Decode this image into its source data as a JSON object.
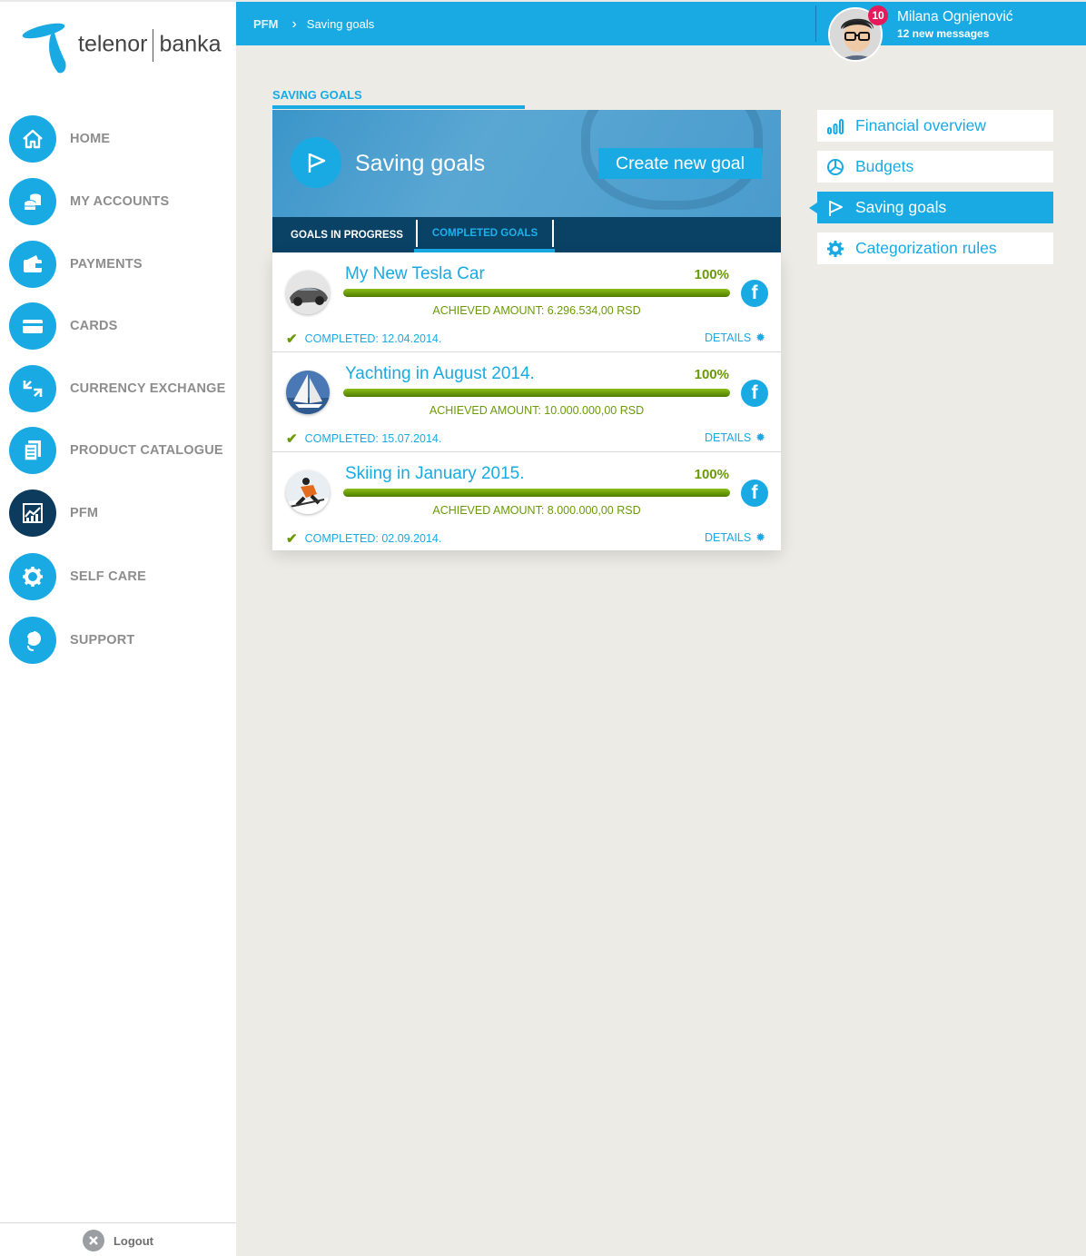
{
  "brand": {
    "name": "telenor",
    "product": "banka",
    "primary_color": "#19aae4",
    "dark_color": "#0a4266",
    "success_color": "#6a9a07"
  },
  "sidebar": {
    "items": [
      {
        "label": "HOME",
        "icon": "home-icon"
      },
      {
        "label": "MY ACCOUNTS",
        "icon": "coins-icon"
      },
      {
        "label": "PAYMENTS",
        "icon": "wallet-icon"
      },
      {
        "label": "CARDS",
        "icon": "card-icon"
      },
      {
        "label": "CURRENCY EXCHANGE",
        "icon": "exchange-icon"
      },
      {
        "label": "PRODUCT CATALOGUE",
        "icon": "catalogue-icon"
      },
      {
        "label": "PFM",
        "icon": "chart-icon",
        "active": true
      },
      {
        "label": "SELF CARE",
        "icon": "gear-icon"
      },
      {
        "label": "SUPPORT",
        "icon": "headset-icon"
      }
    ],
    "logout_label": "Logout"
  },
  "topbar": {
    "breadcrumb_root": "PFM",
    "breadcrumb_current": "Saving goals",
    "user_name": "Milana Ognjenović",
    "messages": "12 new messages",
    "badge_count": "10"
  },
  "main": {
    "section_title": "SAVING GOALS",
    "hero_title": "Saving goals",
    "create_button": "Create new goal",
    "tabs": [
      {
        "label": "GOALS IN PROGRESS",
        "active": false
      },
      {
        "label": "COMPLETED GOALS",
        "active": true
      }
    ],
    "goals": [
      {
        "name": "My New Tesla Car",
        "percent": "100%",
        "progress": 1.0,
        "achieved": "ACHIEVED AMOUNT: 6.296.534,00 RSD",
        "completed": "COMPLETED: 12.04.2014.",
        "details": "DETAILS",
        "image": "car"
      },
      {
        "name": "Yachting in August 2014.",
        "percent": "100%",
        "progress": 1.0,
        "achieved": "ACHIEVED AMOUNT: 10.000.000,00 RSD",
        "completed": "COMPLETED: 15.07.2014.",
        "details": "DETAILS",
        "image": "sailboat"
      },
      {
        "name": "Skiing in January 2015.",
        "percent": "100%",
        "progress": 1.0,
        "achieved": "ACHIEVED AMOUNT: 8.000.000,00 RSD",
        "completed": "COMPLETED: 02.09.2014.",
        "details": "DETAILS",
        "image": "skier"
      }
    ]
  },
  "right_menu": {
    "items": [
      {
        "label": "Financial overview",
        "icon": "bar-chart-icon",
        "active": false
      },
      {
        "label": "Budgets",
        "icon": "pie-chart-icon",
        "active": false
      },
      {
        "label": "Saving goals",
        "icon": "flag-icon",
        "active": true
      },
      {
        "label": "Categorization rules",
        "icon": "gear-icon",
        "active": false
      }
    ]
  }
}
